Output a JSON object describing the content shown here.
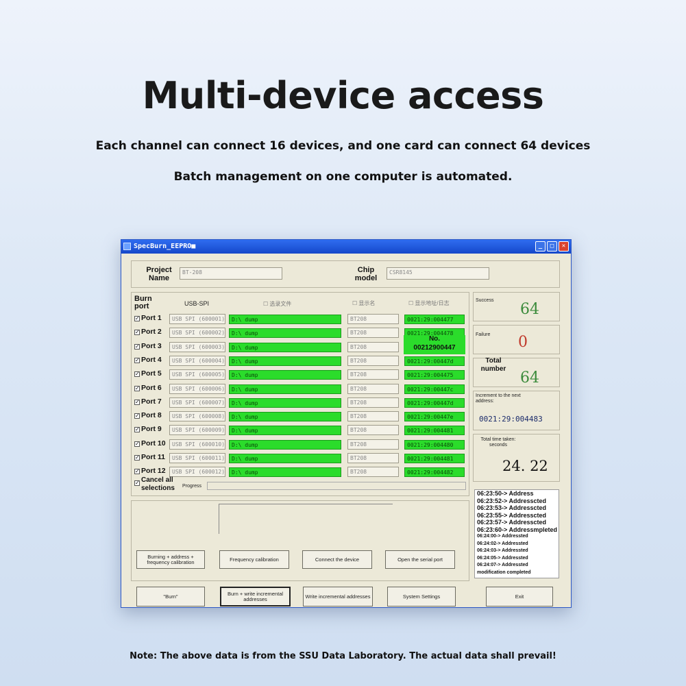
{
  "headline": "Multi-device access",
  "subline1": "Each channel can connect 16 devices, and one card can connect 64 devices",
  "subline2": "Batch management on one computer is automated.",
  "note": "Note: The above data is from the SSU Data Laboratory. The actual data shall prevail!",
  "window": {
    "title": "SpecBurn_EEPRO■",
    "project_label": "Project Name",
    "project_value": "BT-208",
    "chip_label": "Chip model",
    "chip_value": "CSR8145",
    "burn_port_label": "Burn port",
    "usb_spi_label": "USB-SPI",
    "col_hdr1": "☐ 选录文件",
    "col_hdr2": "☐ 显示名",
    "col_hdr3": "☐ 显示地址/日志",
    "overlay_no_label": "No.",
    "overlay_no_value": "00212900447",
    "ports": [
      {
        "label": "Port 1",
        "usb": "USB SPI (600001)",
        "file": "D:\\ dump",
        "name": "BT208",
        "addr": "0021:29:004477"
      },
      {
        "label": "Port 2",
        "usb": "USB SPI (600002)",
        "file": "D:\\ dump",
        "name": "BT208",
        "addr": "0021:29:004478"
      },
      {
        "label": "Port 3",
        "usb": "USB SPI (600003)",
        "file": "D:\\ dump",
        "name": "BT208",
        "addr": ""
      },
      {
        "label": "Port 4",
        "usb": "USB SPI (600004)",
        "file": "D:\\ dump",
        "name": "BT208",
        "addr": "0021:29:00447d"
      },
      {
        "label": "Port 5",
        "usb": "USB SPI (600005)",
        "file": "D:\\ dump",
        "name": "BT208",
        "addr": "0021:29:004475"
      },
      {
        "label": "Port 6",
        "usb": "USB SPI (600006)",
        "file": "D:\\ dump",
        "name": "BT208",
        "addr": "0021:29:00447c"
      },
      {
        "label": "Port 7",
        "usb": "USB SPI (600007)",
        "file": "D:\\ dump",
        "name": "BT208",
        "addr": "0021:29:00447d"
      },
      {
        "label": "Port 8",
        "usb": "USB SPI (600008)",
        "file": "D:\\ dump",
        "name": "BT208",
        "addr": "0021:29:00447e"
      },
      {
        "label": "Port 9",
        "usb": "USB SPI (600009)",
        "file": "D:\\ dump",
        "name": "BT208",
        "addr": "0021:29:004481"
      },
      {
        "label": "Port 10",
        "usb": "USB SPI (600010)",
        "file": "D:\\ dump",
        "name": "BT208",
        "addr": "0021:29:004480"
      },
      {
        "label": "Port 11",
        "usb": "USB SPI (600011)",
        "file": "D:\\ dump",
        "name": "BT208",
        "addr": "0021:29:004481"
      },
      {
        "label": "Port 12",
        "usb": "USB SPI (600012)",
        "file": "D:\\ dump",
        "name": "BT208",
        "addr": "0021:29:004482"
      }
    ],
    "cancel_all_label": "Cancel all selections",
    "progress_label": "Progress",
    "success_label": "Success",
    "success_value": "64",
    "failure_label": "Failure",
    "failure_value": "0",
    "total_label": "Total number",
    "total_value": "64",
    "increment_label": "Increment to the next address:",
    "increment_value": "0021:29:004483",
    "time_label": "Total time taken: seconds",
    "time_value": "24. 22",
    "log_lines": [
      "06:23:50-> Address",
      "06:23:52-> Addresscted",
      "06:23:53-> Addresscted",
      "06:23:55-> Addresscted",
      "06:23:57-> Addresscted",
      "06:23:60-> Addressmpleted"
    ],
    "log_lines_small": [
      "06:24:00-> Addressted",
      "06:24:02-> Addressted",
      "06:24:03-> Addressted",
      "06:24:05-> Addressted",
      "06:24:07-> Addressted",
      "modification completed"
    ],
    "buttons_row1": [
      "Burning + address + frequency calibration",
      "Frequency calibration",
      "Connect the device",
      "Open the serial port"
    ],
    "buttons_row2": [
      "\"Burn\"",
      "Burn + write incremental addresses",
      "Write incremental addresses",
      "System Settings",
      "Exit"
    ]
  },
  "colors": {
    "accent_green": "#2bdc2b",
    "title_blue": "#1547c9",
    "success": "#3a8a3a",
    "failure": "#c0392b"
  }
}
